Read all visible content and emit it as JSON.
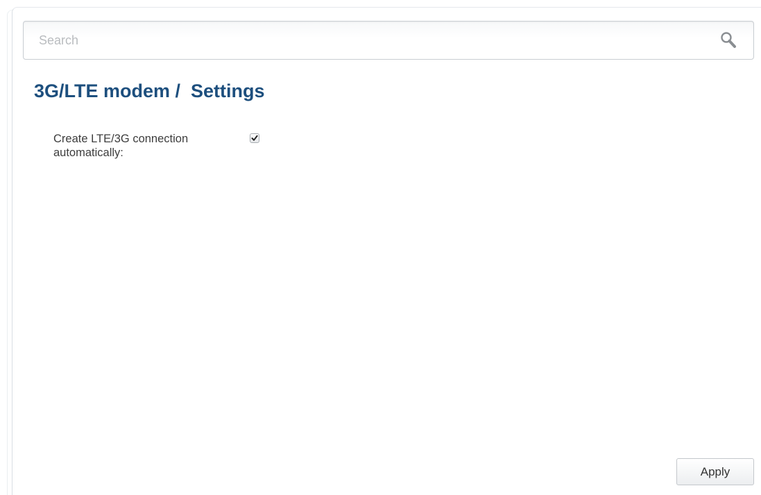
{
  "search": {
    "placeholder": "Search",
    "value": "",
    "icon": "search-icon"
  },
  "header": {
    "title": "3G/LTE modem /  Settings"
  },
  "settings": {
    "auto_connect": {
      "label": "Create LTE/3G connection automatically:",
      "checked": true
    }
  },
  "actions": {
    "apply_label": "Apply"
  },
  "colors": {
    "title": "#1d4f7e",
    "label": "#3d3d3d",
    "placeholder": "#b9bcbf"
  }
}
